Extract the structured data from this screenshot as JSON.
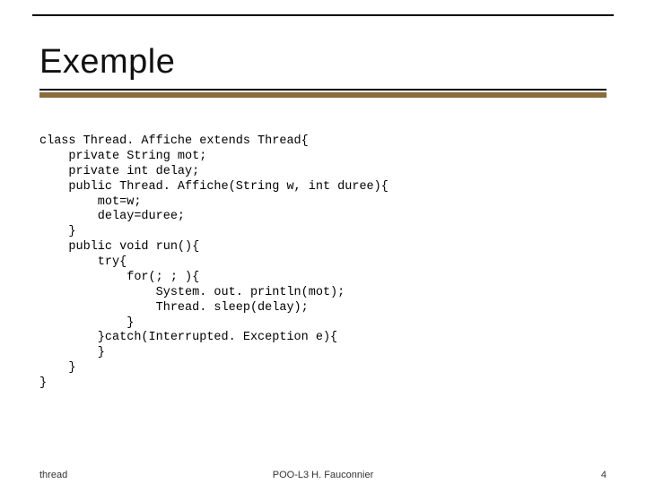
{
  "title": "Exemple",
  "code": "class Thread. Affiche extends Thread{\n    private String mot;\n    private int delay;\n    public Thread. Affiche(String w, int duree){\n        mot=w;\n        delay=duree;\n    }\n    public void run(){\n        try{\n            for(; ; ){\n                System. out. println(mot);\n                Thread. sleep(delay);\n            }\n        }catch(Interrupted. Exception e){\n        }\n    }\n}",
  "footer": {
    "left": "thread",
    "center": "POO-L3 H. Fauconnier",
    "right": "4"
  }
}
